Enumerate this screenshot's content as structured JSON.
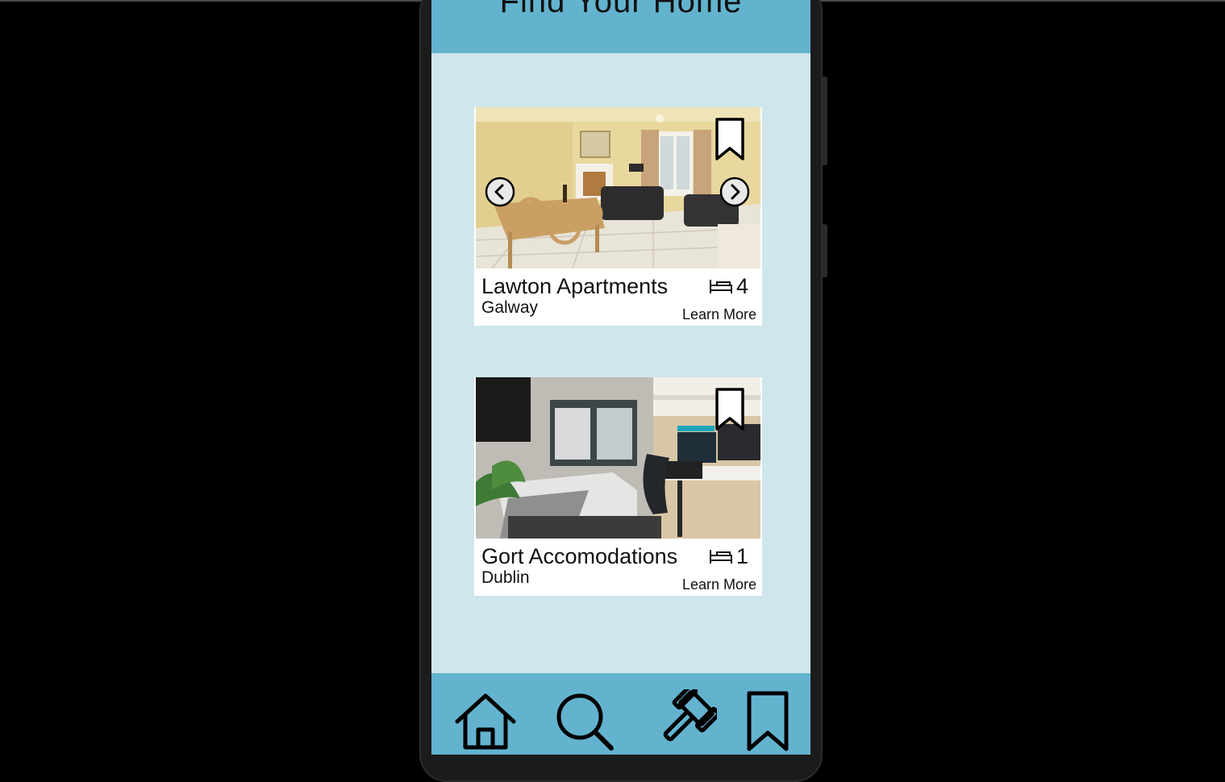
{
  "app": {
    "header_title": "Find Your Home"
  },
  "listings": [
    {
      "name": "Lawton Apartments",
      "city": "Galway",
      "beds": "4",
      "learn_more": "Learn More",
      "image": "living-room-photo"
    },
    {
      "name": "Gort Accomodations",
      "city": "Dublin",
      "beds": "1",
      "learn_more": "Learn More",
      "image": "bedroom-photo"
    }
  ],
  "bottom_nav": [
    "home-icon",
    "search-icon",
    "gavel-icon",
    "bookmark-icon"
  ],
  "colors": {
    "header": "#63b3cf",
    "background": "#cfe6ec",
    "card": "#ffffff",
    "device": "#1b1b1b"
  }
}
